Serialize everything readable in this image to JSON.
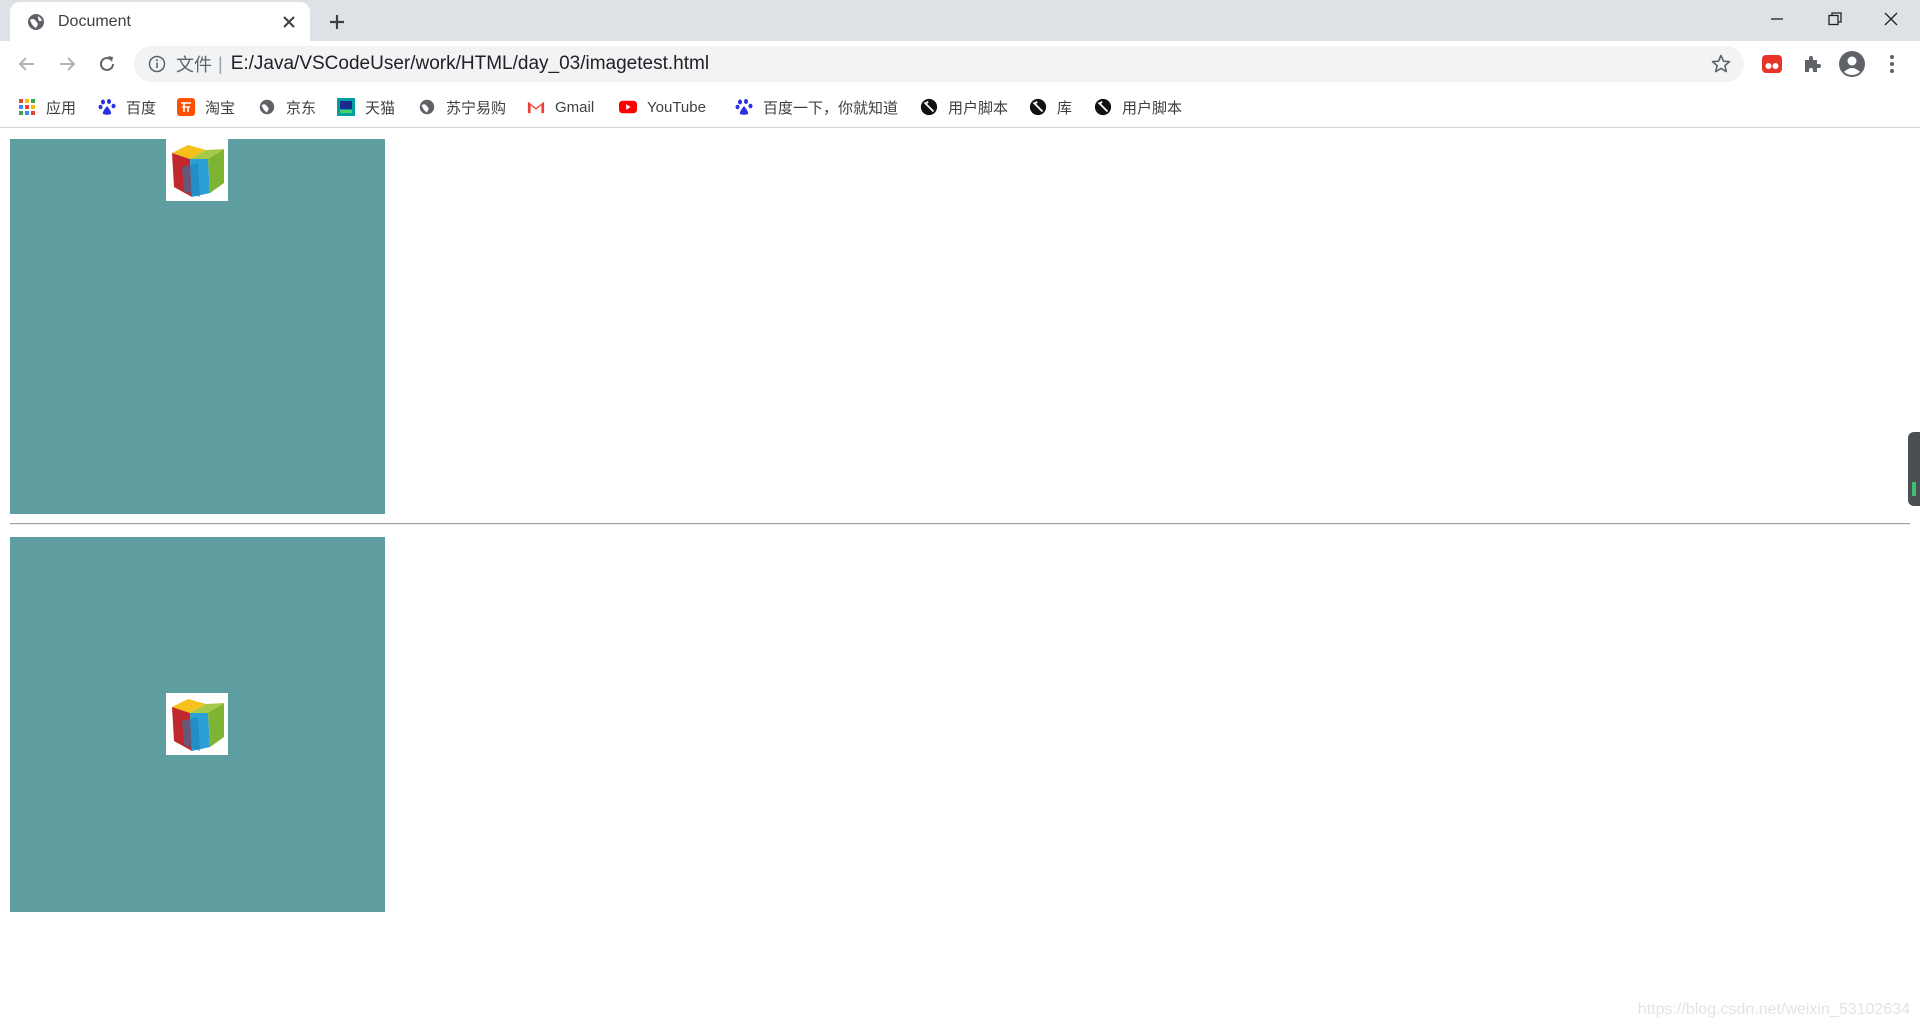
{
  "tab": {
    "title": "Document"
  },
  "omnibox": {
    "scheme_label": "文件",
    "separator": "|",
    "url": "E:/Java/VSCodeUser/work/HTML/day_03/imagetest.html"
  },
  "bookmarks": [
    {
      "label": "应用",
      "icon": "apps-grid-icon"
    },
    {
      "label": "百度",
      "icon": "baidu-paw-icon"
    },
    {
      "label": "淘宝",
      "icon": "taobao-icon"
    },
    {
      "label": "京东",
      "icon": "globe-icon"
    },
    {
      "label": "天猫",
      "icon": "tmall-icon"
    },
    {
      "label": "苏宁易购",
      "icon": "globe-icon"
    },
    {
      "label": "Gmail",
      "icon": "gmail-icon"
    },
    {
      "label": "YouTube",
      "icon": "youtube-icon"
    },
    {
      "label": "百度一下，你就知道",
      "icon": "baidu-paw-icon"
    },
    {
      "label": "用户脚本",
      "icon": "userscript-icon"
    },
    {
      "label": "库",
      "icon": "userscript-icon"
    },
    {
      "label": "用户脚本",
      "icon": "userscript-icon"
    }
  ],
  "page": {
    "box_color": "#5f9ea0",
    "watermark": "https://blog.csdn.net/weixin_53102634"
  }
}
